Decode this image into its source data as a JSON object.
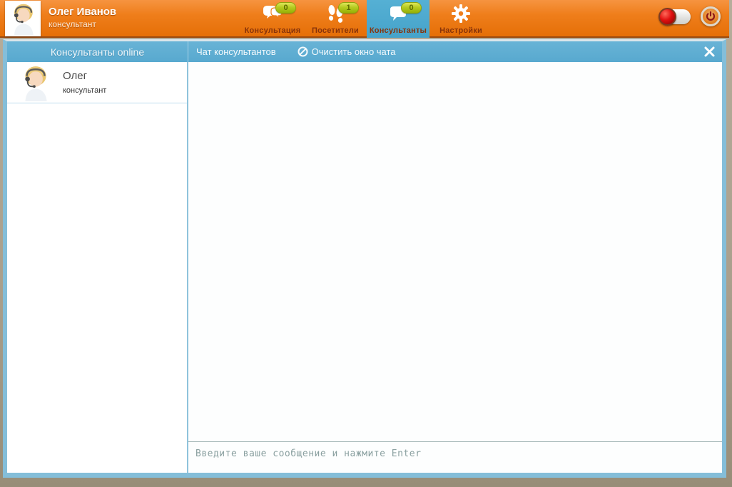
{
  "header": {
    "user": {
      "name": "Олег Иванов",
      "role": "консультант"
    },
    "tabs": [
      {
        "label": "Консультация",
        "badge": "0",
        "icon": "chat-bubbles-icon",
        "active": false
      },
      {
        "label": "Посетители",
        "badge": "1",
        "icon": "footprints-icon",
        "active": false
      },
      {
        "label": "Консультанты",
        "badge": "0",
        "icon": "chat-bubble-icon",
        "active": true
      },
      {
        "label": "Настройки",
        "badge": null,
        "icon": "gear-icon",
        "active": false
      }
    ],
    "controls": {
      "status_toggle_state": "off-left-red",
      "power_icon": "power-icon"
    }
  },
  "sidebar": {
    "header": "Консультанты online",
    "consultants": [
      {
        "name": "Олег",
        "role": "консультант"
      }
    ]
  },
  "chat": {
    "title": "Чат консультантов",
    "clear_button_label": "Очистить окно чата",
    "clear_button_icon": "ban-circle-icon",
    "close_icon": "close-x-icon",
    "messages": [],
    "input_placeholder": "Введите ваше сообщение и нажмите Enter"
  },
  "colors": {
    "header_orange": "#ef7e1b",
    "active_tab_blue": "#4aa6cc",
    "panel_header_blue": "#5fadd2",
    "window_border_blue": "#84bed9",
    "badge_green": "#a9c214",
    "badge_text": "#5f6c00",
    "tab_label_brown": "#87330a",
    "desktop_tan": "#a99f8c",
    "toggle_knob_red": "#e01010",
    "input_placeholder_grey": "#8aa0a0"
  }
}
